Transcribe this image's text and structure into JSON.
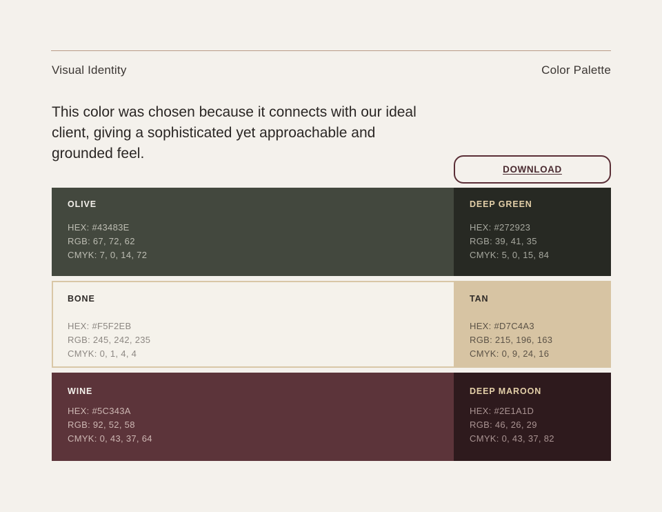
{
  "header": {
    "left_label": "Visual Identity",
    "right_label": "Color Palette"
  },
  "intro_text": "This color was chosen because it connects with our ideal client, giving a sophisticated yet approachable and grounded feel.",
  "download_label": "DOWNLOAD",
  "colors": {
    "page_background": "#F4F1EC",
    "rule": "#B89A86",
    "button_border": "#5A2E36"
  },
  "palette": [
    {
      "main": {
        "name": "OLIVE",
        "hex": "HEX: #43483E",
        "rgb": "RGB: 67, 72, 62",
        "cmyk": "CMYK: 7, 0, 14, 72",
        "color": "#43483E"
      },
      "accent": {
        "name": "DEEP GREEN",
        "hex": "HEX: #272923",
        "rgb": "RGB: 39, 41, 35",
        "cmyk": "CMYK: 5, 0, 15, 84",
        "color": "#272923"
      }
    },
    {
      "main": {
        "name": "BONE",
        "hex": "HEX: #F5F2EB",
        "rgb": "RGB: 245, 242, 235",
        "cmyk": "CMYK: 0, 1, 4, 4",
        "color": "#F5F2EB"
      },
      "accent": {
        "name": "TAN",
        "hex": "HEX: #D7C4A3",
        "rgb": "RGB: 215, 196, 163",
        "cmyk": "CMYK: 0, 9, 24, 16",
        "color": "#D7C4A3"
      }
    },
    {
      "main": {
        "name": "WINE",
        "hex": "HEX: #5C343A",
        "rgb": "RGB: 92, 52, 58",
        "cmyk": "CMYK: 0, 43, 37, 64",
        "color": "#5C343A"
      },
      "accent": {
        "name": "DEEP MAROON",
        "hex": "HEX: #2E1A1D",
        "rgb": "RGB: 46, 26, 29",
        "cmyk": "CMYK: 0, 43, 37, 82",
        "color": "#2E1A1D"
      }
    }
  ]
}
